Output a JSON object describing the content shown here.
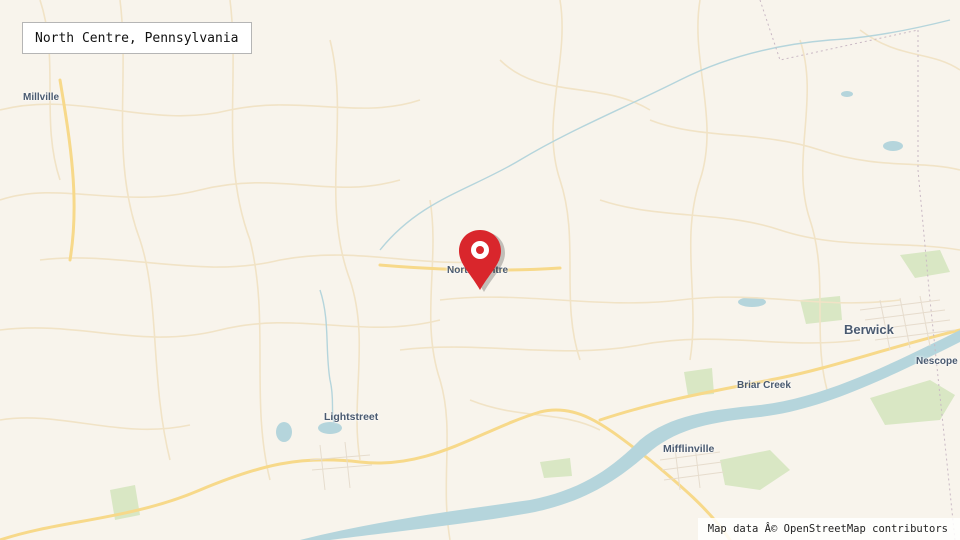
{
  "map": {
    "title": "North Centre, Pennsylvania",
    "attribution": "Map data Â© OpenStreetMap contributors",
    "marker": {
      "name": "map-pin-icon",
      "color": "#d9262c"
    },
    "places": [
      {
        "id": "millville",
        "label": "Millville"
      },
      {
        "id": "north-centre",
        "label": "North Centre"
      },
      {
        "id": "berwick",
        "label": "Berwick"
      },
      {
        "id": "nescopeck",
        "label": "Nescope"
      },
      {
        "id": "briar-creek",
        "label": "Briar Creek"
      },
      {
        "id": "lightstreet",
        "label": "Lightstreet"
      },
      {
        "id": "mifflinville",
        "label": "Mifflinville"
      }
    ],
    "colors": {
      "land": "#f8f4ec",
      "road_major": "#f7d98a",
      "road_minor": "#f1e3c6",
      "water": "#b5d5dc",
      "green": "#d9e7c4",
      "label": "#4a5a70"
    }
  }
}
